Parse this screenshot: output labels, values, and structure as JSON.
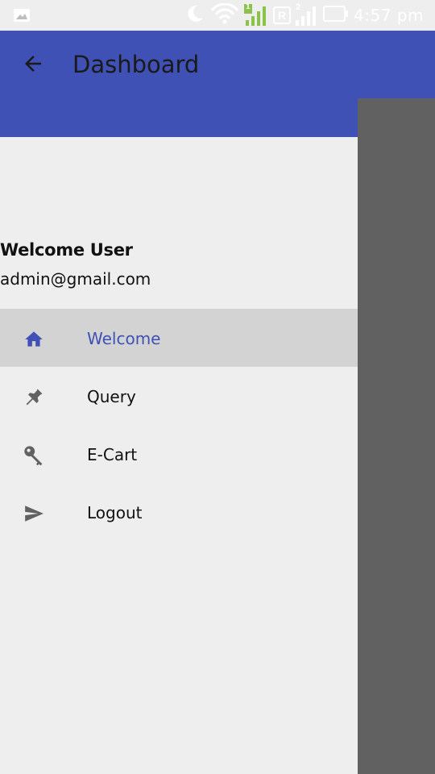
{
  "status_bar": {
    "time": "4:57 pm",
    "sim1_label": "1",
    "roaming_label": "R",
    "sim2_label": "2"
  },
  "app_bar": {
    "title": "Dashboard",
    "color": "#3f51b5"
  },
  "drawer": {
    "user_name": "Welcome User",
    "user_email": "admin@gmail.com",
    "items": [
      {
        "label": "Welcome",
        "icon": "home-icon",
        "active": true
      },
      {
        "label": "Query",
        "icon": "pin-icon",
        "active": false
      },
      {
        "label": "E-Cart",
        "icon": "key-icon",
        "active": false
      },
      {
        "label": "Logout",
        "icon": "send-icon",
        "active": false
      }
    ],
    "accent_color": "#3f51b5"
  }
}
